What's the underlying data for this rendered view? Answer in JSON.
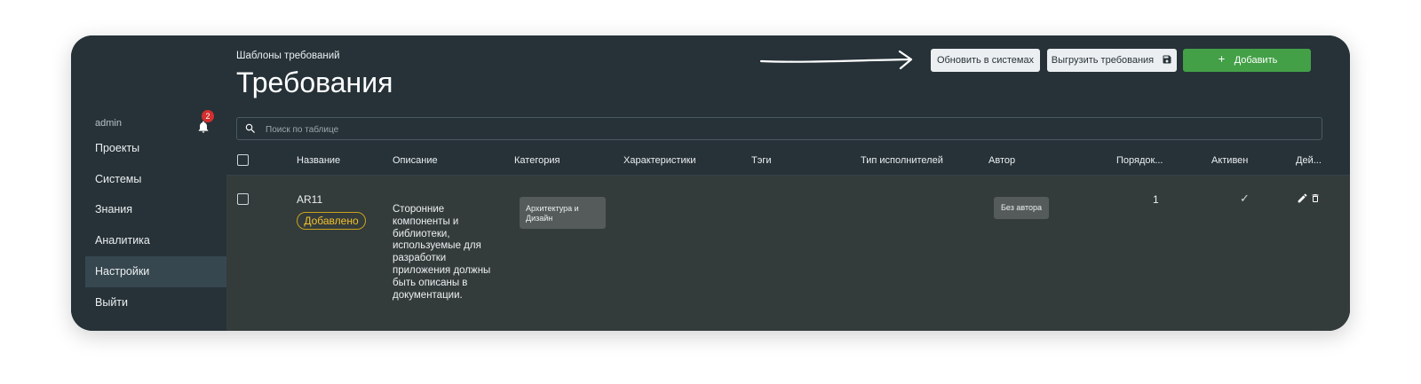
{
  "sidebar": {
    "username": "admin",
    "notification_count": "2",
    "items": [
      {
        "label": "Проекты"
      },
      {
        "label": "Системы"
      },
      {
        "label": "Знания"
      },
      {
        "label": "Аналитика"
      },
      {
        "label": "Настройки",
        "active": true
      },
      {
        "label": "Выйти"
      }
    ]
  },
  "header": {
    "breadcrumb": "Шаблоны требований",
    "title": "Требования",
    "buttons": {
      "update": "Обновить в системах",
      "export": "Выгрузить требования",
      "add": "Добавить"
    }
  },
  "search": {
    "placeholder": "Поиск по таблице"
  },
  "table": {
    "columns": [
      "Название",
      "Описание",
      "Категория",
      "Характеристики",
      "Тэги",
      "Тип исполнителей",
      "Автор",
      "Порядок...",
      "Активен",
      "Дей..."
    ],
    "rows": [
      {
        "name": "AR11",
        "status": "Добавлено",
        "description": "Сторонние компоненты и библиотеки, используемые для разработки приложения должны быть описаны в документации.",
        "category": "Архитектура и Дизайн",
        "author": "Без автора",
        "order": "1",
        "active": "✓"
      }
    ]
  },
  "colors": {
    "background": "#263238",
    "row_background": "#343b3b",
    "accent_green": "#43a047",
    "status_yellow": "#f2c12e",
    "badge_red": "#d32f2f"
  },
  "icons": [
    "bell-icon",
    "search-icon",
    "save-icon",
    "plus-icon",
    "edit-icon",
    "delete-icon",
    "checkmark-icon",
    "arrow-icon"
  ]
}
